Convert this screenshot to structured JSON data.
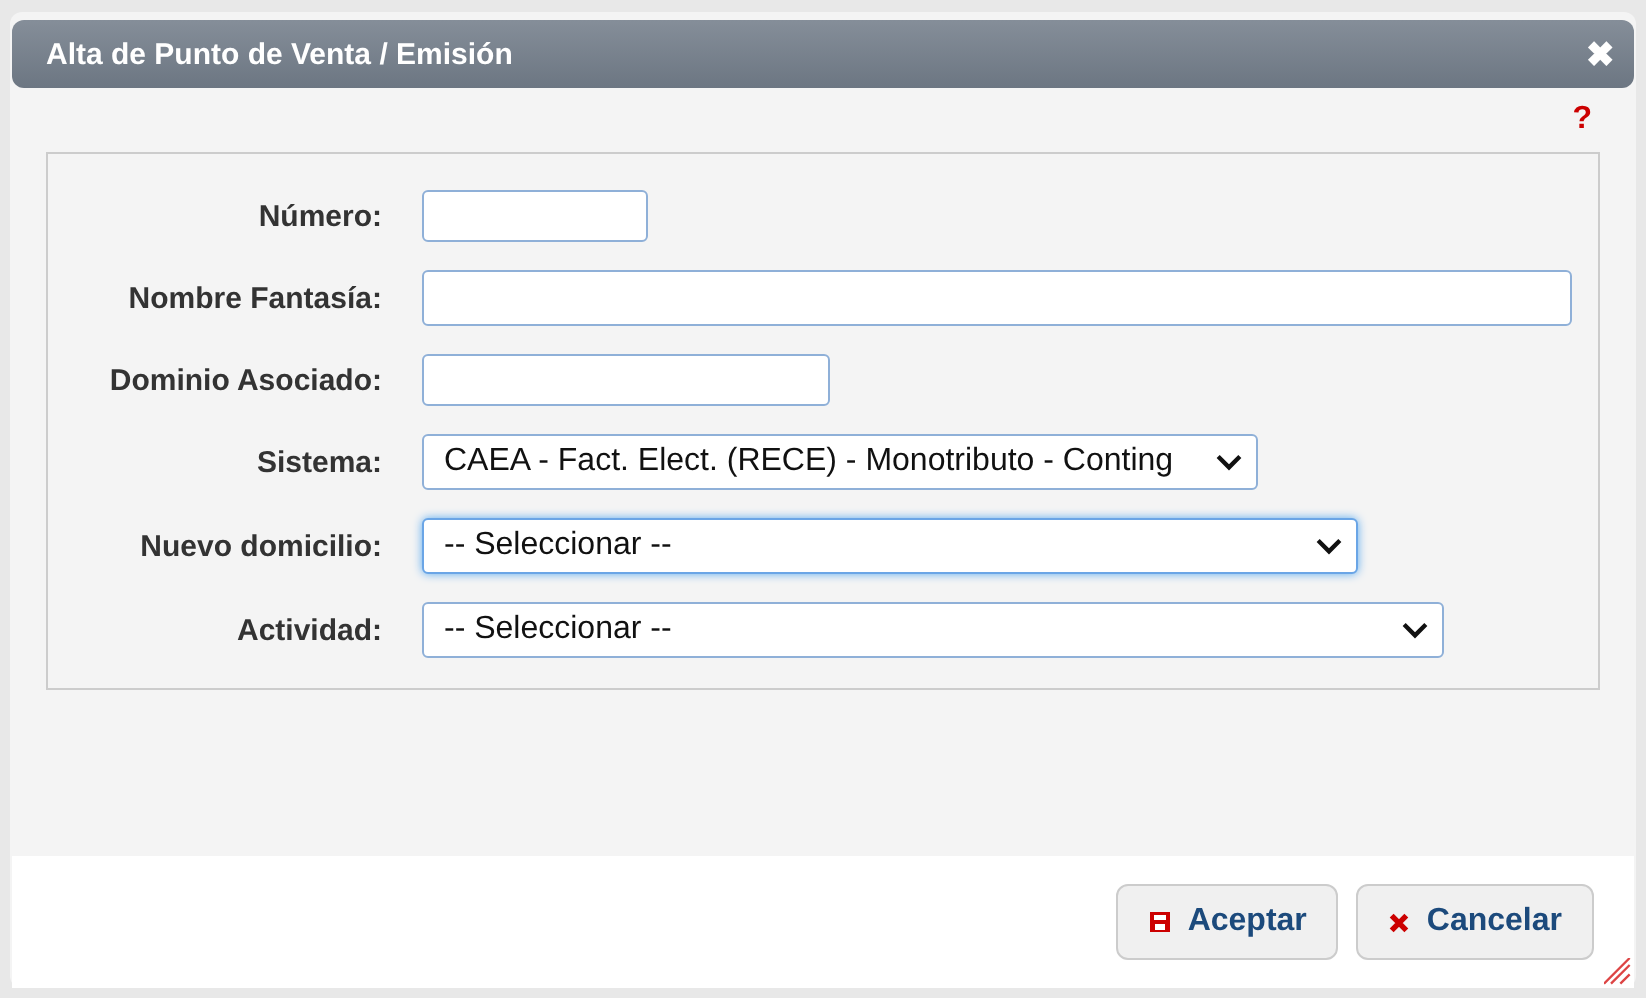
{
  "dialog": {
    "title": "Alta de Punto de Venta / Emisión",
    "close_icon": "✖",
    "help": "?"
  },
  "fields": [
    {
      "label": "Número:",
      "kind": "input",
      "focused": false
    },
    {
      "label": "Nombre Fantasía:",
      "kind": "input",
      "focused": false
    },
    {
      "label": "Dominio Asociado:",
      "kind": "input",
      "focused": false
    },
    {
      "label": "Sistema:",
      "kind": "select",
      "value": "CAEA - Fact. Elect. (RECE) - Monotributo - Conting",
      "focused": false
    },
    {
      "label": "Nuevo domicilio:",
      "kind": "select",
      "value": "-- Seleccionar --",
      "focused": true
    },
    {
      "label": "Actividad:",
      "kind": "select",
      "value": "-- Seleccionar --",
      "focused": false
    }
  ],
  "buttons": [
    {
      "label": "Aceptar",
      "kind": "save"
    },
    {
      "label": "Cancelar",
      "kind": "cancel"
    }
  ]
}
